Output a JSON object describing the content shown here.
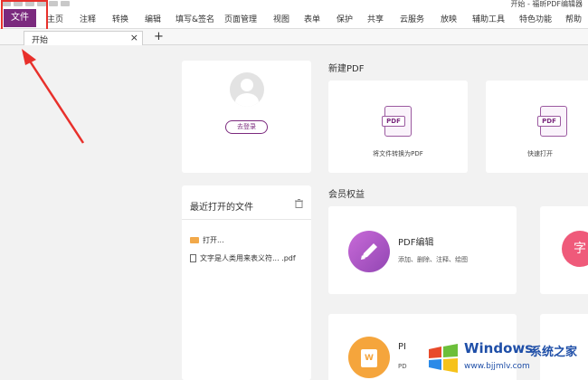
{
  "window": {
    "title": "开始 - 福昕PDF编辑器"
  },
  "menu": {
    "file": "文件",
    "items": [
      "主页",
      "注释",
      "转换",
      "编辑",
      "填写&签名",
      "页面管理",
      "视图",
      "表单",
      "保护",
      "共享",
      "云服务",
      "放映",
      "辅助工具",
      "特色功能",
      "帮助"
    ]
  },
  "tabs": {
    "active_label": "开始",
    "close_glyph": "×",
    "add_glyph": "+"
  },
  "login": {
    "button_label": "去登录"
  },
  "recent": {
    "title": "最近打开的文件",
    "open_label": "打开...",
    "file_name": "文字是人类用来表义符... .pdf"
  },
  "new_pdf": {
    "section_title": "新建PDF",
    "card1_icon_text": "PDF",
    "card1_label": "将文件转换为PDF",
    "card2_icon_text": "PDF",
    "card2_label": "快速打开"
  },
  "member": {
    "section_title": "会员权益",
    "edit_title": "PDF编辑",
    "edit_sub": "添加、删除、注释、绘图",
    "zi_glyph": "字",
    "word_glyph": "W",
    "pf_title": "PI",
    "pf_sub": "PD"
  },
  "watermark": {
    "brand": "Windows",
    "brand_cn": "系统之家",
    "url": "www.bjjmlv.com"
  },
  "colors": {
    "accent": "#7b2a7e",
    "annotation_red": "#e8302b",
    "edit_purple": "#9246b3",
    "zi_pink": "#ef5a7a",
    "word_orange": "#f5a53c"
  }
}
